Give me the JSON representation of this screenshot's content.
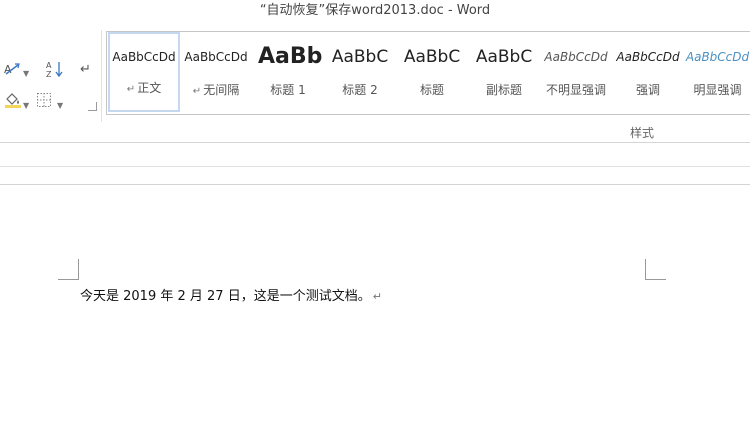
{
  "window": {
    "title": "“自动恢复”保存word2013.doc - Word"
  },
  "paragraph_tools": {
    "text_direction_icon": "text-direction-icon",
    "sort_label": "A↓Z",
    "show_marks_symbol": "↵",
    "shading_icon": "paint-bucket-icon",
    "borders_icon": "borders-icon"
  },
  "styles_gallery": {
    "group_label": "样式",
    "items": [
      {
        "preview": "AaBbCcDd",
        "label": "正文",
        "selected": true
      },
      {
        "preview": "AaBbCcDd",
        "label": "无间隔",
        "selected": false
      },
      {
        "preview": "AaBb",
        "label": "标题 1",
        "selected": false
      },
      {
        "preview": "AaBbC",
        "label": "标题 2",
        "selected": false
      },
      {
        "preview": "AaBbC",
        "label": "标题",
        "selected": false
      },
      {
        "preview": "AaBbC",
        "label": "副标题",
        "selected": false
      },
      {
        "preview": "AaBbCcDd",
        "label": "不明显强调",
        "selected": false
      },
      {
        "preview": "AaBbCcDd",
        "label": "强调",
        "selected": false
      },
      {
        "preview": "AaBbCcDd",
        "label": "明显强调",
        "selected": false
      }
    ]
  },
  "document": {
    "body_text": "今天是 2019 年 2 月 27 日，这是一个测试文档。",
    "paragraph_mark": "↵"
  },
  "colors": {
    "accent_intense": "#4a90c2",
    "selection_border": "#c5d8ef"
  }
}
